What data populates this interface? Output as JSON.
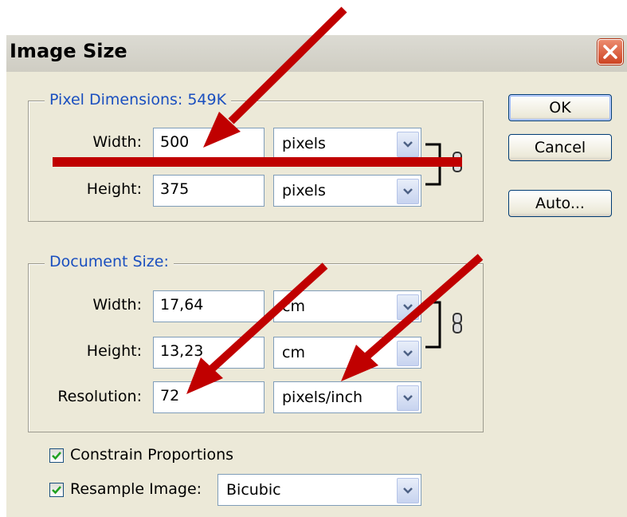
{
  "dialog": {
    "title": "Image Size",
    "close_icon": "close-icon"
  },
  "pixel_dimensions": {
    "legend": "Pixel Dimensions: 549K",
    "width_label": "Width:",
    "width_value": "500",
    "width_unit": "pixels",
    "height_label": "Height:",
    "height_value": "375",
    "height_unit": "pixels"
  },
  "document_size": {
    "legend": "Document Size:",
    "width_label": "Width:",
    "width_value": "17,64",
    "width_unit": "cm",
    "height_label": "Height:",
    "height_value": "13,23",
    "height_unit": "cm",
    "resolution_label": "Resolution:",
    "resolution_value": "72",
    "resolution_unit": "pixels/inch"
  },
  "buttons": {
    "ok": "OK",
    "cancel": "Cancel",
    "auto": "Auto..."
  },
  "options": {
    "constrain_label": "Constrain Proportions",
    "constrain_checked": true,
    "resample_label": "Resample Image:",
    "resample_checked": true,
    "resample_method": "Bicubic"
  },
  "annotation": {
    "arrow_color": "#c00000"
  }
}
